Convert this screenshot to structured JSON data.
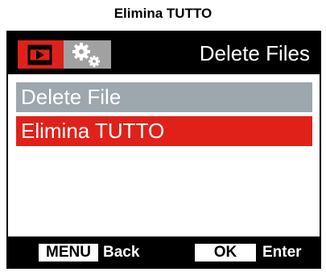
{
  "caption": "Elimina TUTTO",
  "header": {
    "title": "Delete Files",
    "tabs": [
      {
        "icon": "playback-icon",
        "active": true
      },
      {
        "icon": "settings-gears-icon",
        "active": false
      }
    ]
  },
  "menu": {
    "items": [
      {
        "label": "Delete File",
        "state": "normal"
      },
      {
        "label": "Elimina TUTTO",
        "state": "selected"
      }
    ]
  },
  "footer": {
    "menu_key": "MENU",
    "menu_label": "Back",
    "ok_key": "OK",
    "ok_label": "Enter"
  },
  "colors": {
    "accent_red": "#e0211a",
    "item_gray": "#9ca7ae",
    "tab_gray": "#a1a1a1",
    "background_black": "#000000"
  }
}
